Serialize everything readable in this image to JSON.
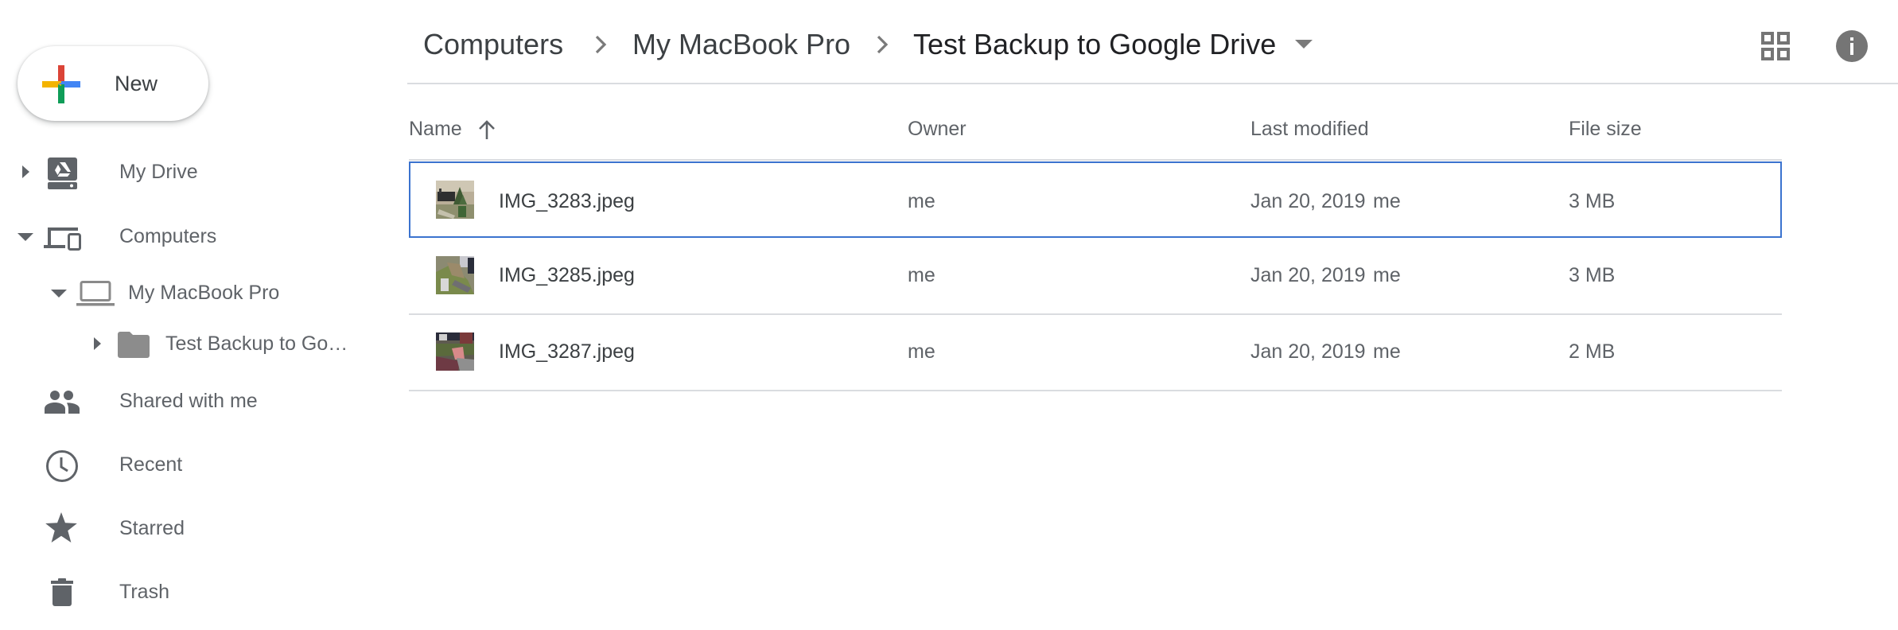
{
  "sidebar": {
    "new_button_label": "New",
    "items": [
      {
        "label": "My Drive",
        "icon": "my-drive-icon",
        "expander": "collapsed"
      },
      {
        "label": "Computers",
        "icon": "computers-icon",
        "expander": "expanded"
      },
      {
        "label": "My MacBook Pro",
        "icon": "laptop-icon",
        "expander": "expanded"
      },
      {
        "label": "Test Backup to Go…",
        "icon": "folder-icon",
        "expander": "collapsed"
      },
      {
        "label": "Shared with me",
        "icon": "people-icon"
      },
      {
        "label": "Recent",
        "icon": "clock-icon"
      },
      {
        "label": "Starred",
        "icon": "star-icon"
      },
      {
        "label": "Trash",
        "icon": "trash-icon"
      }
    ]
  },
  "breadcrumb": {
    "items": [
      "Computers",
      "My MacBook Pro",
      "Test Backup to Google Drive"
    ]
  },
  "toolbar": {
    "grid_view_icon": "grid-view-icon",
    "info_icon": "info-icon"
  },
  "table": {
    "columns": [
      "Name",
      "Owner",
      "Last modified",
      "File size"
    ],
    "sort": {
      "column": "Name",
      "direction": "ascending"
    },
    "rows": [
      {
        "name": "IMG_3283.jpeg",
        "owner": "me",
        "modified_date": "Jan 20, 2019",
        "modified_by": "me",
        "size": "3 MB",
        "selected": true
      },
      {
        "name": "IMG_3285.jpeg",
        "owner": "me",
        "modified_date": "Jan 20, 2019",
        "modified_by": "me",
        "size": "3 MB",
        "selected": false
      },
      {
        "name": "IMG_3287.jpeg",
        "owner": "me",
        "modified_date": "Jan 20, 2019",
        "modified_by": "me",
        "size": "2 MB",
        "selected": false
      }
    ]
  },
  "colors": {
    "selection_border": "#3b73cf",
    "icon_gray": "#5f6368",
    "plus_red": "#db4437",
    "plus_blue": "#4285f4",
    "plus_green": "#0f9d58",
    "plus_yellow": "#f4b400"
  }
}
